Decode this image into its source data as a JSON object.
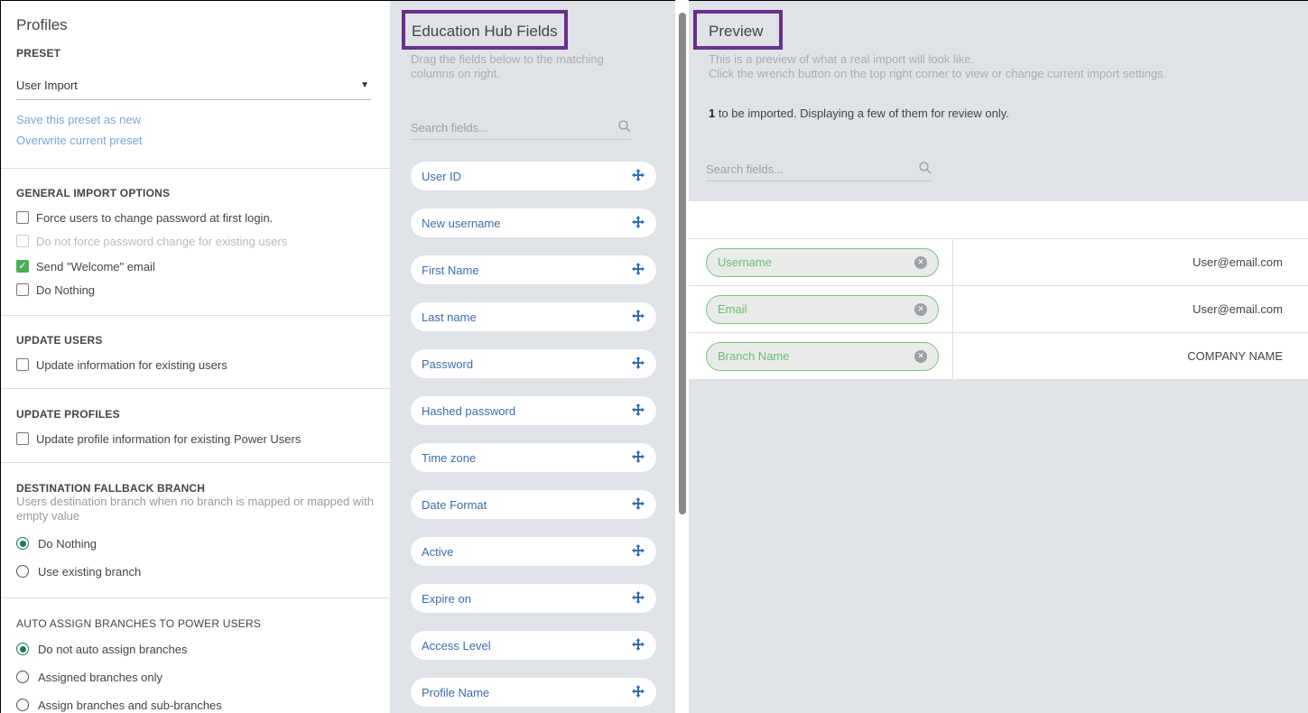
{
  "left": {
    "title": "Profiles",
    "preset_label": "PRESET",
    "preset_value": "User Import",
    "save_link": "Save this preset as new",
    "overwrite_link": "Overwrite current preset",
    "general": {
      "heading": "GENERAL IMPORT OPTIONS",
      "options": [
        {
          "label": "Force users to change password at first login.",
          "checked": false,
          "disabled": false
        },
        {
          "label": "Do not force password change for existing users",
          "checked": false,
          "disabled": true
        },
        {
          "label": "Send \"Welcome\" email",
          "checked": true,
          "disabled": false
        },
        {
          "label": "Do Nothing",
          "checked": false,
          "disabled": false
        }
      ]
    },
    "update_users": {
      "heading": "UPDATE USERS",
      "option": "Update information for existing users"
    },
    "update_profiles": {
      "heading": "UPDATE PROFILES",
      "option": "Update profile information for existing Power Users"
    },
    "fallback": {
      "heading": "DESTINATION FALLBACK BRANCH",
      "sub": "Users destination branch when no branch is mapped or mapped with empty value",
      "options": [
        {
          "label": "Do Nothing",
          "selected": true
        },
        {
          "label": "Use existing branch",
          "selected": false
        }
      ]
    },
    "auto_assign": {
      "heading": "AUTO ASSIGN BRANCHES TO POWER USERS",
      "options": [
        {
          "label": "Do not auto assign branches",
          "selected": true
        },
        {
          "label": "Assigned branches only",
          "selected": false
        },
        {
          "label": "Assign branches and sub-branches",
          "selected": false
        }
      ]
    }
  },
  "mid": {
    "title": "Education Hub Fields",
    "desc": "Drag the fields below to the matching columns on right.",
    "search_placeholder": "Search fields...",
    "fields": [
      "User ID",
      "New username",
      "First Name",
      "Last name",
      "Password",
      "Hashed password",
      "Time zone",
      "Date Format",
      "Active",
      "Expire on",
      "Access Level",
      "Profile Name"
    ]
  },
  "right": {
    "title": "Preview",
    "desc_line1": "This is a preview of what a real import will look like.",
    "desc_line2": "Click the wrench button on the top right corner to view or change current import settings.",
    "count_number": "1",
    "count_text": " to be imported. Displaying a few of them for review only.",
    "search_placeholder": "Search fields...",
    "rows": [
      {
        "field": "Username",
        "value": "User@email.com"
      },
      {
        "field": "Email",
        "value": "User@email.com"
      },
      {
        "field": "Branch Name",
        "value": "COMPANY NAME"
      }
    ]
  },
  "colors": {
    "accent_box": "#6b2d8f",
    "link": "#7aa9d2",
    "field_text": "#3b6ea8",
    "mapped_green": "#6cbf6e",
    "radio_green": "#1b7a55"
  }
}
